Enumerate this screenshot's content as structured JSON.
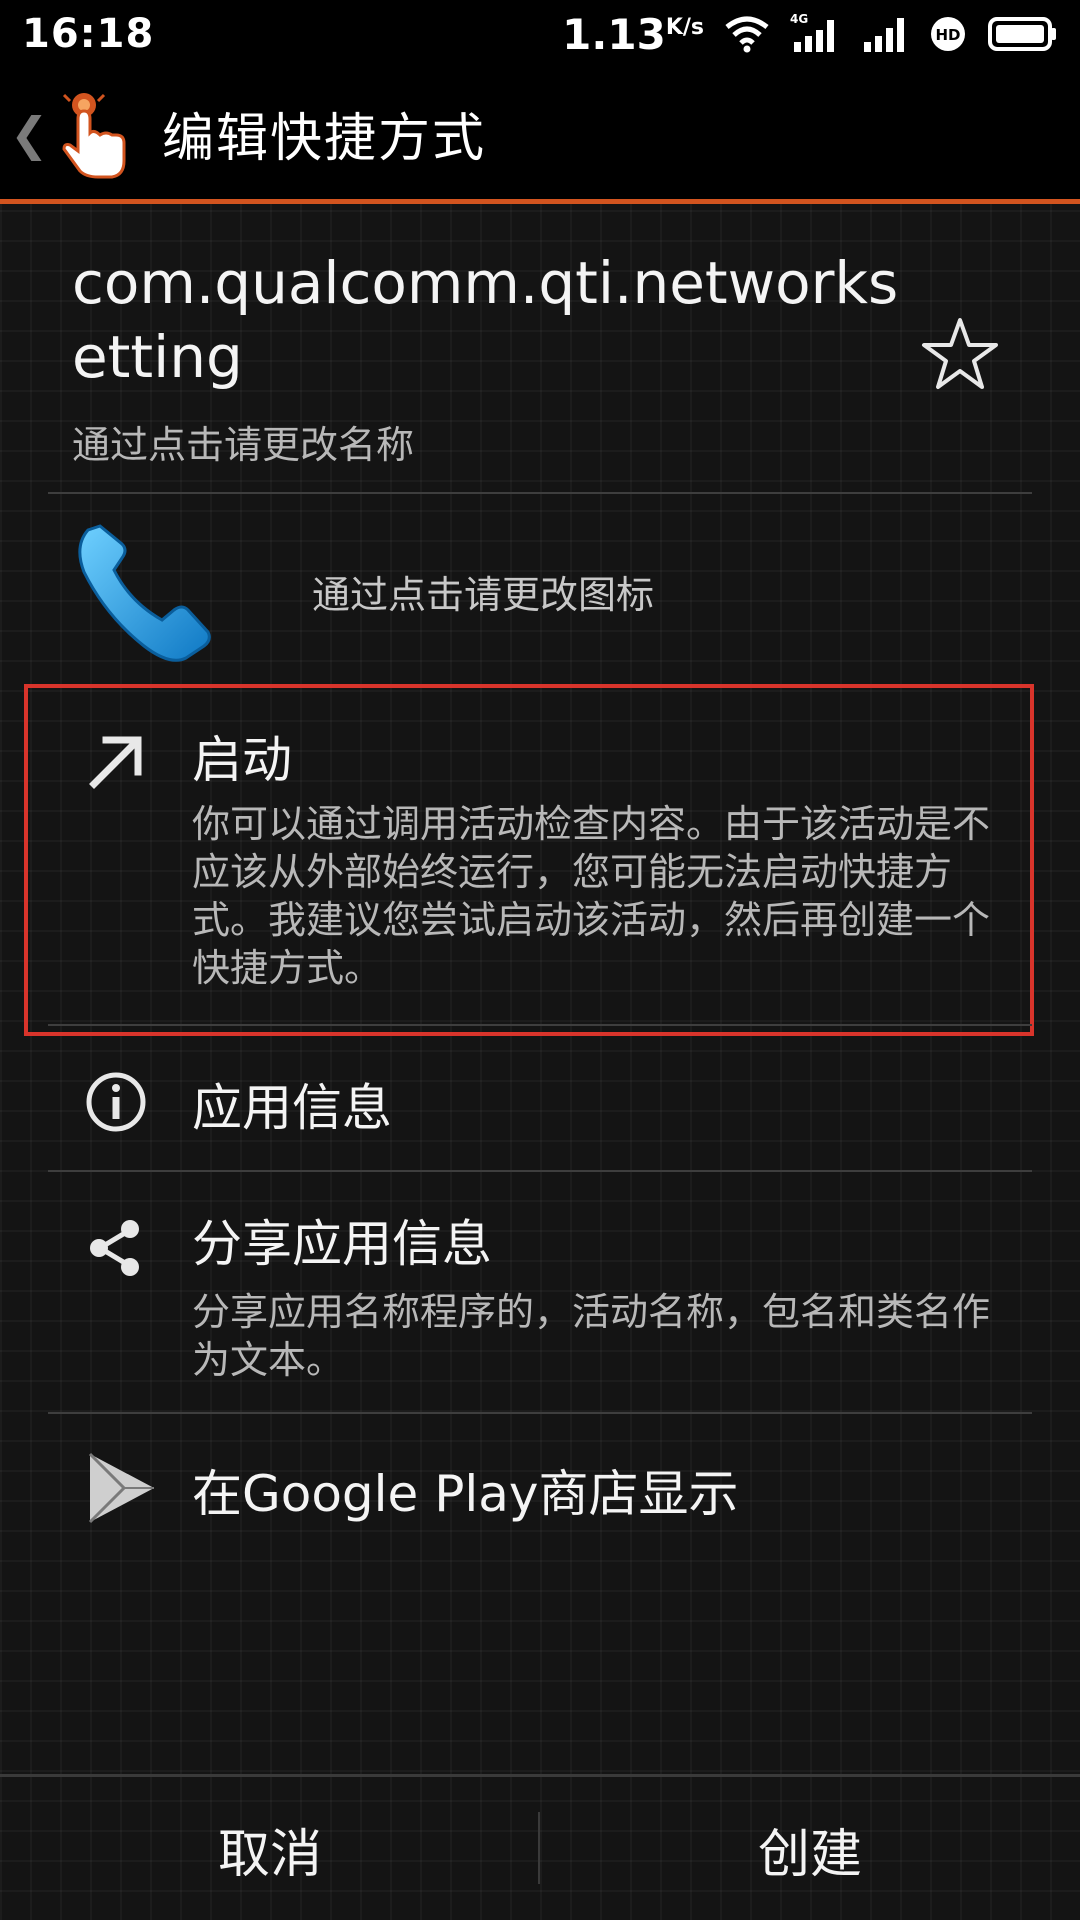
{
  "status_bar": {
    "time": "16:18",
    "speed": "1.13",
    "speed_unit": "K/s",
    "network": "4G",
    "hd_badge": "HD"
  },
  "app_bar": {
    "title": "编辑快捷方式",
    "back_icon": "chevron-left-icon",
    "logo_icon": "tap-hand-icon"
  },
  "shortcut": {
    "name": "com.qualcomm.qti.networksetting",
    "name_hint": "通过点击请更改名称",
    "icon_hint": "通过点击请更改图标",
    "icon": "phone-icon",
    "favorite_icon": "star-outline-icon"
  },
  "menu": {
    "launch": {
      "title": "启动",
      "desc": "你可以通过调用活动检查内容。由于该活动是不应该从外部始终运行，您可能无法启动快捷方式。我建议您尝试启动该活动，然后再创建一个快捷方式。",
      "icon": "arrow-up-right-icon"
    },
    "app_info": {
      "title": "应用信息",
      "icon": "info-icon"
    },
    "share": {
      "title": "分享应用信息",
      "desc": "分享应用名称程序的，活动名称，包名和类名作为文本。",
      "icon": "share-icon"
    },
    "play_store": {
      "title": "在Google Play商店显示",
      "icon": "play-store-icon"
    }
  },
  "buttons": {
    "cancel": "取消",
    "create": "创建"
  },
  "colors": {
    "accent": "#d2541f",
    "highlight": "#d9342b",
    "phone_blue": "#1f9be0"
  }
}
